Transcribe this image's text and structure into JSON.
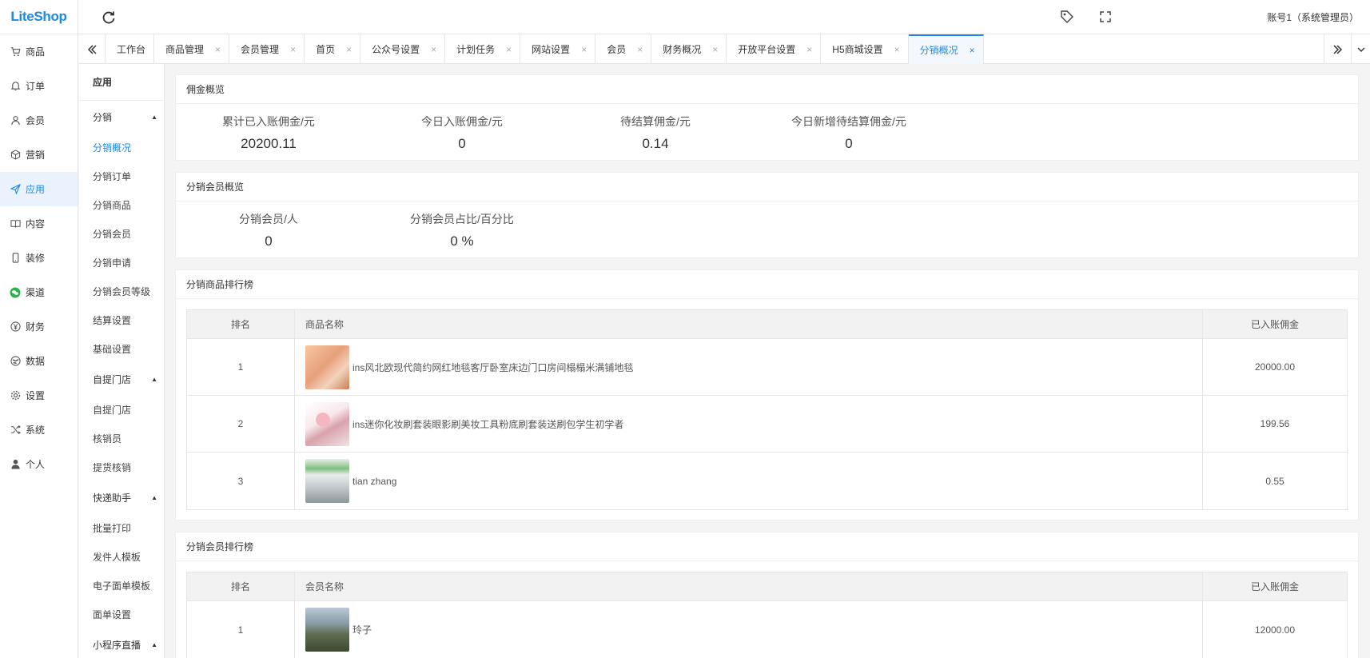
{
  "app": {
    "logo": "LiteShop"
  },
  "header": {
    "account": "账号1（系统管理员）"
  },
  "mainnav": [
    {
      "label": "商品",
      "icon": "cart-icon"
    },
    {
      "label": "订单",
      "icon": "bell-icon"
    },
    {
      "label": "会员",
      "icon": "user-icon"
    },
    {
      "label": "营销",
      "icon": "box-icon"
    },
    {
      "label": "应用",
      "icon": "send-icon",
      "active": true
    },
    {
      "label": "内容",
      "icon": "book-icon"
    },
    {
      "label": "装修",
      "icon": "phone-icon"
    },
    {
      "label": "渠道",
      "icon": "wechat-icon"
    },
    {
      "label": "财务",
      "icon": "yen-icon"
    },
    {
      "label": "数据",
      "icon": "globe-icon"
    },
    {
      "label": "设置",
      "icon": "gear-icon"
    },
    {
      "label": "系统",
      "icon": "shuffle-icon"
    },
    {
      "label": "个人",
      "icon": "person-icon"
    }
  ],
  "tabs": [
    {
      "label": "工作台",
      "closable": false
    },
    {
      "label": "商品管理",
      "closable": true
    },
    {
      "label": "会员管理",
      "closable": true
    },
    {
      "label": "首页",
      "closable": true
    },
    {
      "label": "公众号设置",
      "closable": true
    },
    {
      "label": "计划任务",
      "closable": true
    },
    {
      "label": "网站设置",
      "closable": true
    },
    {
      "label": "会员",
      "closable": true
    },
    {
      "label": "财务概况",
      "closable": true
    },
    {
      "label": "开放平台设置",
      "closable": true
    },
    {
      "label": "H5商城设置",
      "closable": true
    },
    {
      "label": "分销概况",
      "closable": true,
      "active": true
    }
  ],
  "submenu": {
    "title": "应用",
    "groups": [
      {
        "label": "分销",
        "items": [
          "分销概况",
          "分销订单",
          "分销商品",
          "分销会员",
          "分销申请",
          "分销会员等级",
          "结算设置",
          "基础设置"
        ]
      },
      {
        "label": "自提门店",
        "items": [
          "自提门店",
          "核销员",
          "提货核销"
        ]
      },
      {
        "label": "快递助手",
        "items": [
          "批量打印",
          "发件人模板",
          "电子面单模板",
          "面单设置"
        ]
      },
      {
        "label": "小程序直播",
        "items": []
      }
    ],
    "active_item": "分销概况"
  },
  "commission": {
    "title": "佣金概览",
    "stats": [
      {
        "label": "累计已入账佣金/元",
        "value": "20200.11"
      },
      {
        "label": "今日入账佣金/元",
        "value": "0"
      },
      {
        "label": "待结算佣金/元",
        "value": "0.14"
      },
      {
        "label": "今日新增待结算佣金/元",
        "value": "0"
      }
    ]
  },
  "members": {
    "title": "分销会员概览",
    "stats": [
      {
        "label": "分销会员/人",
        "value": "0"
      },
      {
        "label": "分销会员占比/百分比",
        "value": "0 %"
      }
    ]
  },
  "product_rank": {
    "title": "分销商品排行榜",
    "headers": [
      "排名",
      "商品名称",
      "已入账佣金"
    ],
    "rows": [
      {
        "rank": "1",
        "name": "ins风北欧现代简约网红地毯客厅卧室床边门口房间榻榻米满铺地毯",
        "amount": "20000.00"
      },
      {
        "rank": "2",
        "name": "ins迷你化妆刷套装眼影刷美妆工具粉底刷套装送刷包学生初学者",
        "amount": "199.56"
      },
      {
        "rank": "3",
        "name": "tian zhang",
        "amount": "0.55"
      }
    ]
  },
  "member_rank": {
    "title": "分销会员排行榜",
    "headers": [
      "排名",
      "会员名称",
      "已入账佣金"
    ],
    "rows": [
      {
        "rank": "1",
        "name": "玲子",
        "amount": "12000.00"
      }
    ]
  }
}
